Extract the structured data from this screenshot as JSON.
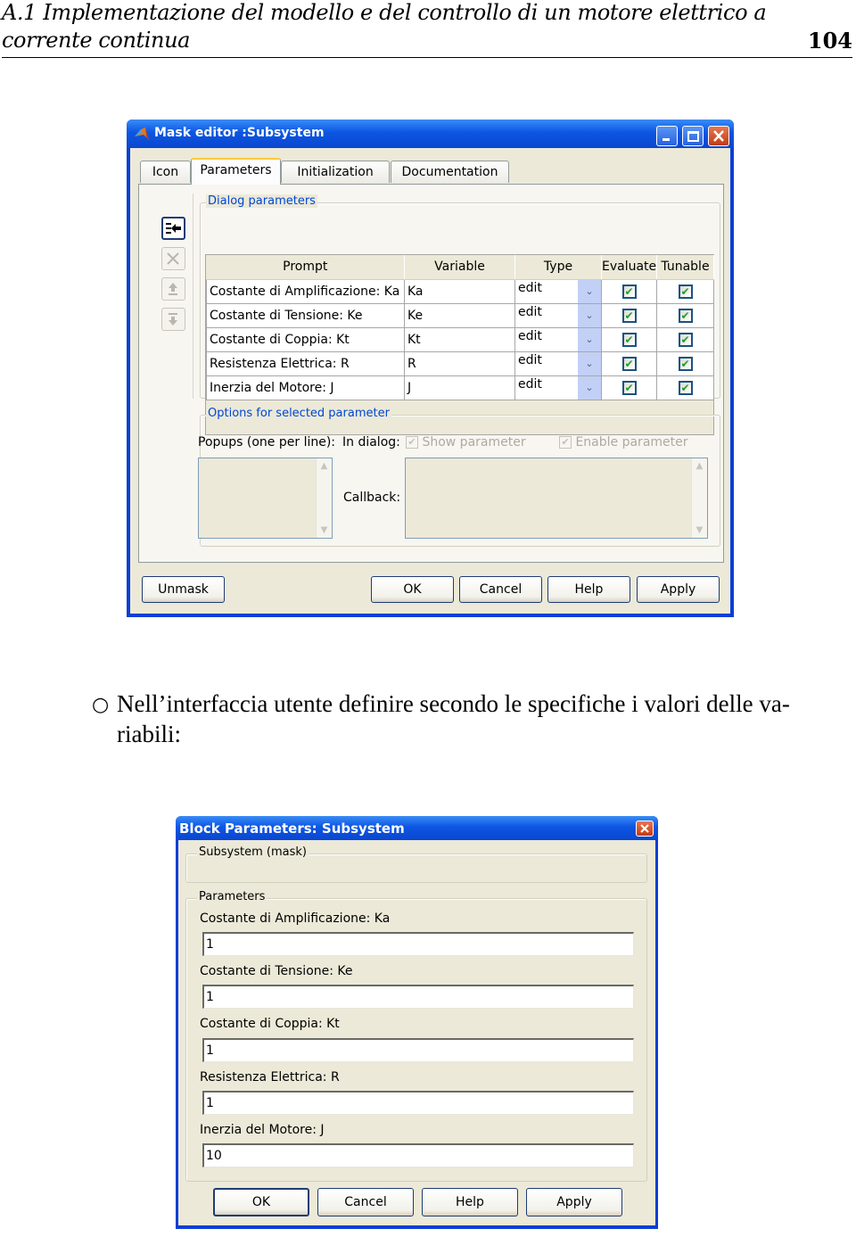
{
  "page_header": {
    "line1": "A.1 Implementazione del modello e del controllo di un motore elettrico a",
    "line2": "corrente continua",
    "page_number": "104"
  },
  "mask_editor": {
    "title": "Mask editor :Subsystem",
    "title_icon": "matlab-icon",
    "window_buttons": [
      "minimize",
      "maximize",
      "close"
    ],
    "tabs": [
      {
        "label": "Icon",
        "active": false
      },
      {
        "label": "Parameters",
        "active": true
      },
      {
        "label": "Initialization",
        "active": false
      },
      {
        "label": "Documentation",
        "active": false
      }
    ],
    "side_buttons": [
      "add-parameter",
      "delete-parameter",
      "move-up",
      "move-down"
    ],
    "dialog_parameters_label": "Dialog parameters",
    "table": {
      "columns": [
        "Prompt",
        "Variable",
        "Type",
        "Evaluate",
        "Tunable"
      ],
      "rows": [
        {
          "prompt": "Costante di Amplificazione: Ka",
          "variable": "Ka",
          "type": "edit",
          "evaluate": true,
          "tunable": true
        },
        {
          "prompt": "Costante di Tensione: Ke",
          "variable": "Ke",
          "type": "edit",
          "evaluate": true,
          "tunable": true
        },
        {
          "prompt": "Costante di Coppia: Kt",
          "variable": "Kt",
          "type": "edit",
          "evaluate": true,
          "tunable": true
        },
        {
          "prompt": "Resistenza Elettrica: R",
          "variable": "R",
          "type": "edit",
          "evaluate": true,
          "tunable": true
        },
        {
          "prompt": "Inerzia del Motore: J",
          "variable": "J",
          "type": "edit",
          "evaluate": true,
          "tunable": true
        }
      ]
    },
    "options_label": "Options for selected parameter",
    "popups_label": "Popups (one per line):",
    "in_dialog_label": "In dialog:",
    "show_parameter_label": "Show parameter",
    "enable_parameter_label": "Enable parameter",
    "callback_label": "Callback:",
    "buttons": {
      "unmask": "Unmask",
      "ok": "OK",
      "cancel": "Cancel",
      "help": "Help",
      "apply": "Apply"
    },
    "checkmark": "✔",
    "dropdown_glyph": "⌄"
  },
  "paragraph": {
    "bullet": "○",
    "line1": "Nell’interfaccia utente definire secondo le specifiche i valori delle va-",
    "line2": "riabili:"
  },
  "block_parameters": {
    "title": "Block Parameters: Subsystem",
    "mask_group_label": "Subsystem (mask)",
    "parameters_group_label": "Parameters",
    "fields": [
      {
        "label": "Costante di Amplificazione: Ka",
        "value": "1"
      },
      {
        "label": "Costante di Tensione: Ke",
        "value": "1"
      },
      {
        "label": "Costante di Coppia: Kt",
        "value": "1"
      },
      {
        "label": "Resistenza Elettrica: R",
        "value": "1"
      },
      {
        "label": "Inerzia del Motore: J",
        "value": "10"
      }
    ],
    "buttons": {
      "ok": "OK",
      "cancel": "Cancel",
      "help": "Help",
      "apply": "Apply"
    }
  },
  "colors": {
    "titlebar_blue": "#0c56e3",
    "dialog_bg": "#ece9d8",
    "group_label_blue": "#0046d5",
    "check_green": "#21a121",
    "close_red": "#c33b14"
  }
}
